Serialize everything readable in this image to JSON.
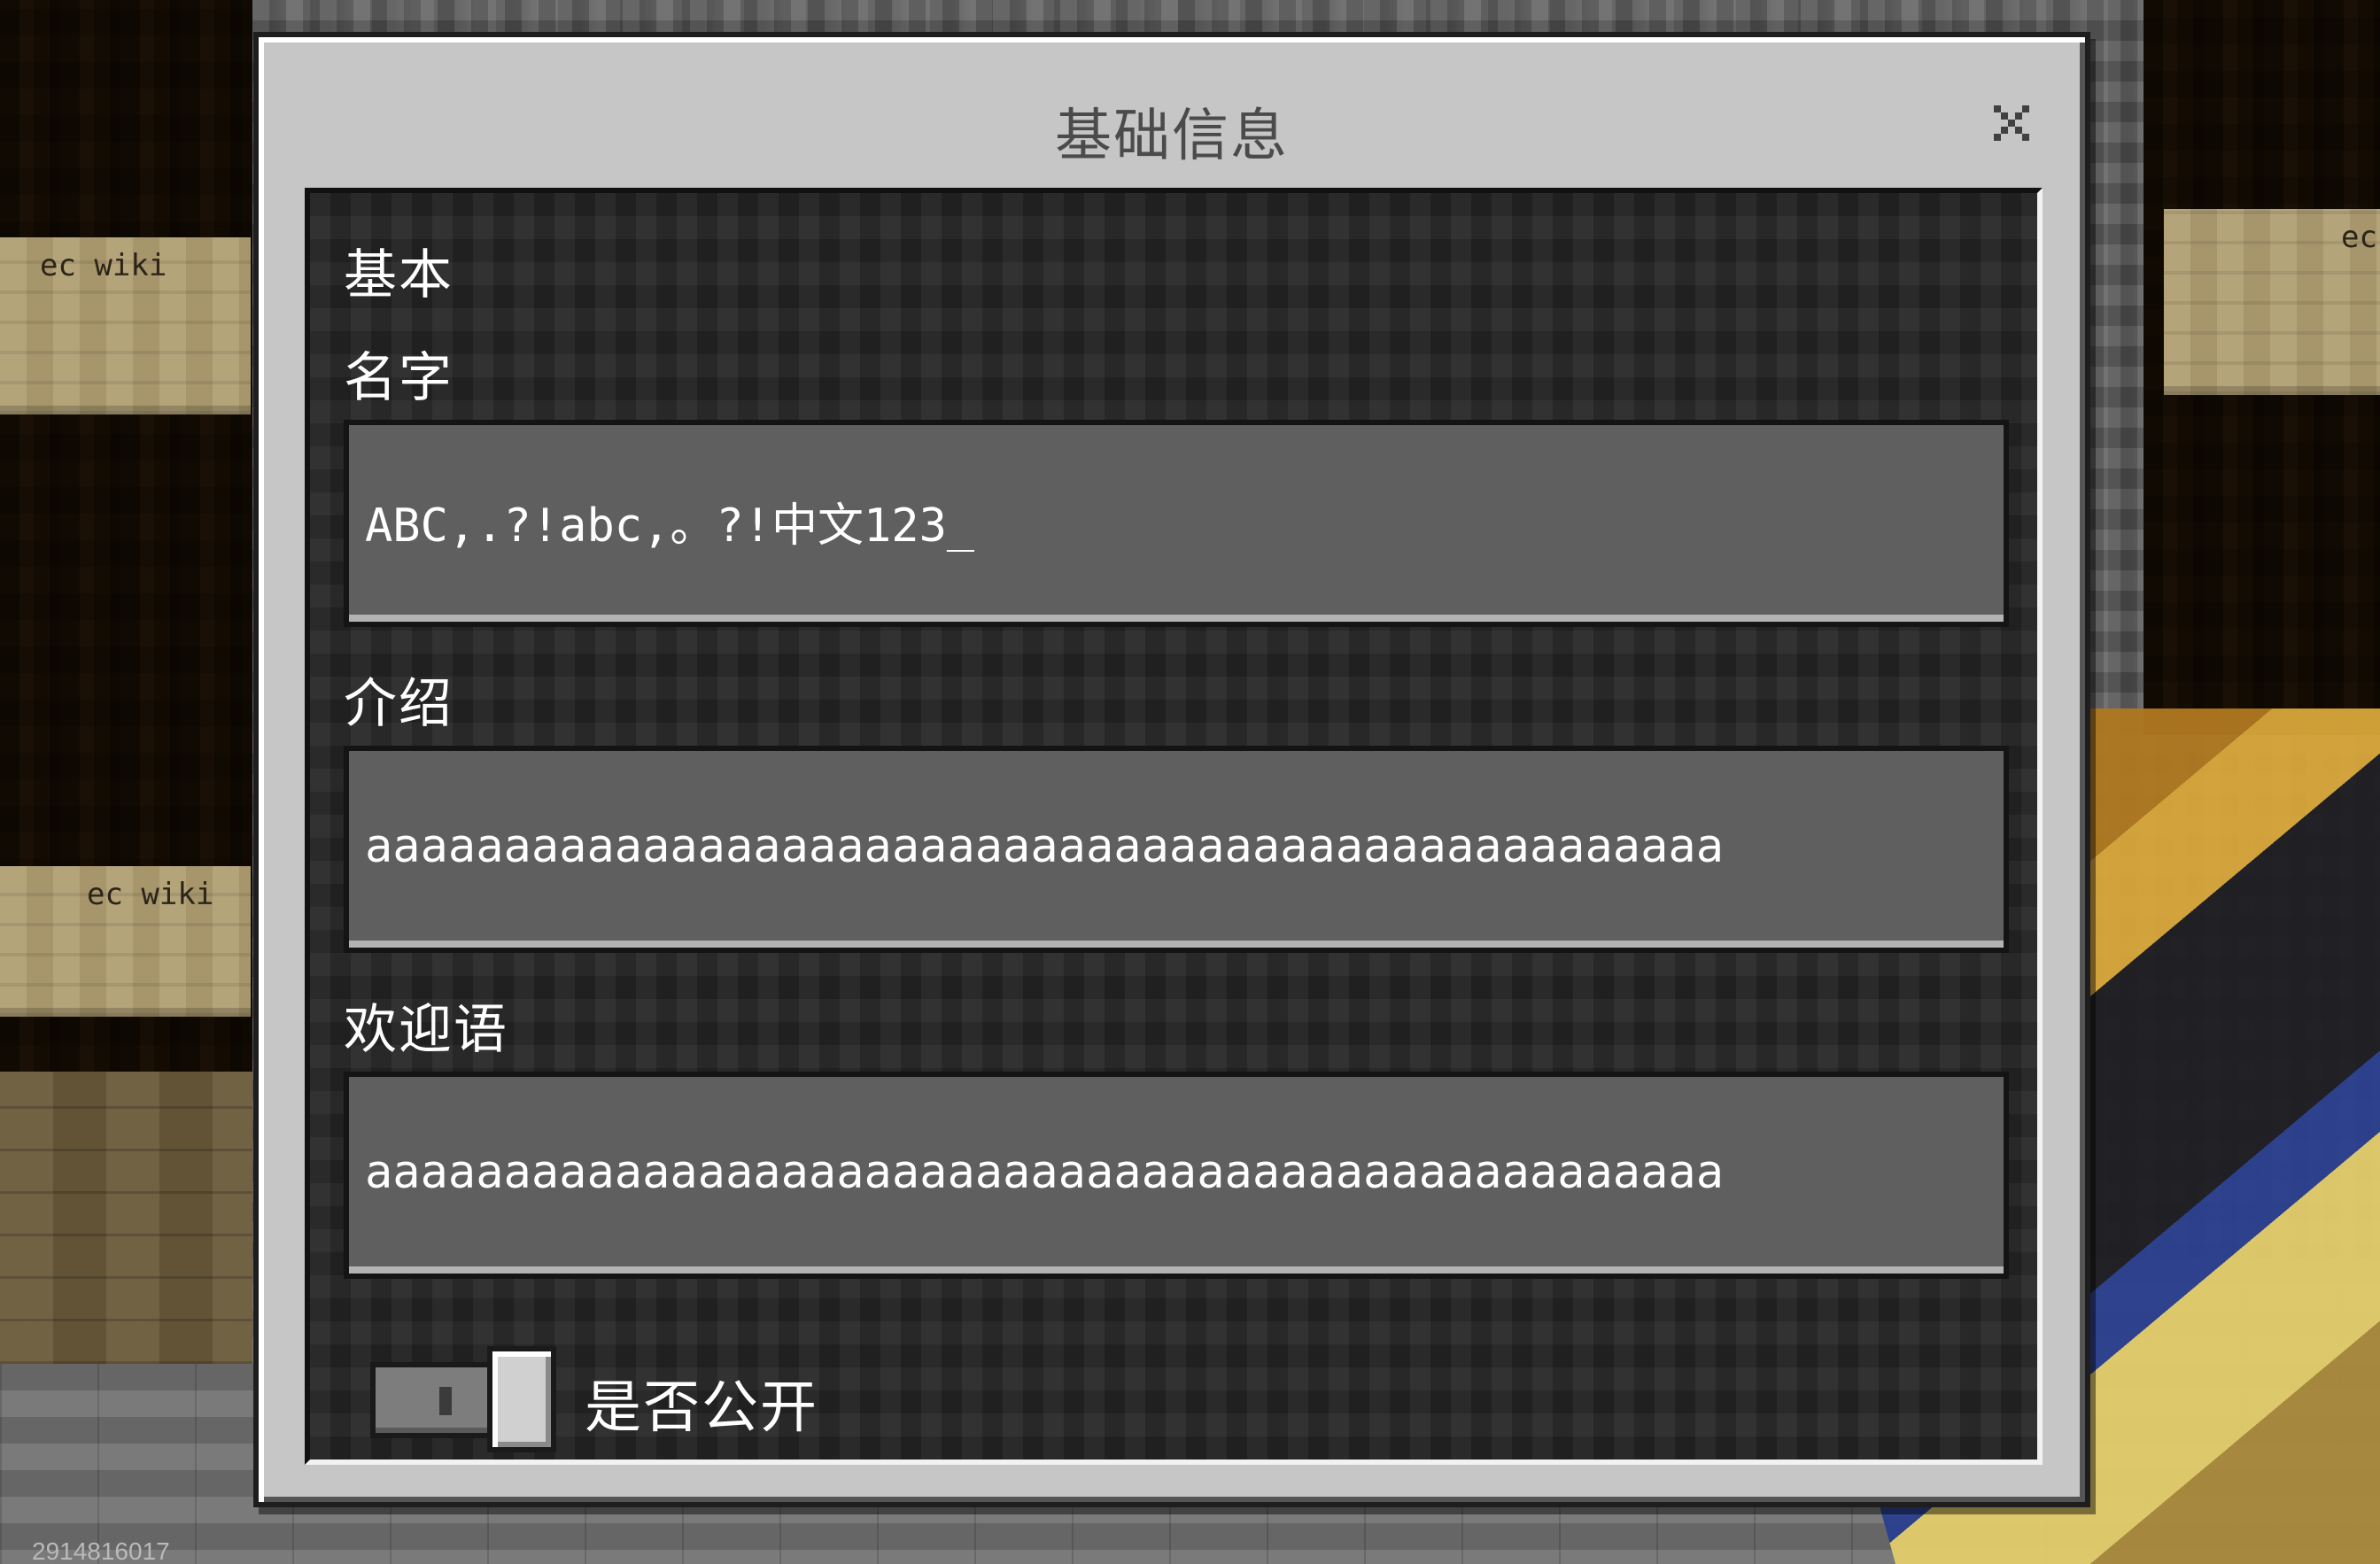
{
  "dialog": {
    "title": "基础信息",
    "close_icon": "close-icon",
    "section_heading": "基本",
    "fields": {
      "name": {
        "label": "名字",
        "value": "ABC,.?!abc,。?!中文123_"
      },
      "intro": {
        "label": "介绍",
        "value": "aaaaaaaaaaaaaaaaaaaaaaaaaaaaaaaaaaaaaaaaaaaaaaaaa"
      },
      "welcome": {
        "label": "欢迎语",
        "value": "aaaaaaaaaaaaaaaaaaaaaaaaaaaaaaaaaaaaaaaaaaaaaaaaa"
      }
    },
    "public_toggle": {
      "label": "是否公开",
      "state": "off"
    }
  },
  "background": {
    "signs": [
      "ec wiki",
      "ec wiki",
      "ec"
    ],
    "seed_text": "2914816017"
  },
  "colors": {
    "dialog_bg": "#c6c6c6",
    "panel_bg": "#262626",
    "field_bg": "#5f5f5f",
    "text_light": "#ffffff",
    "title_text": "#4b4b4b"
  }
}
